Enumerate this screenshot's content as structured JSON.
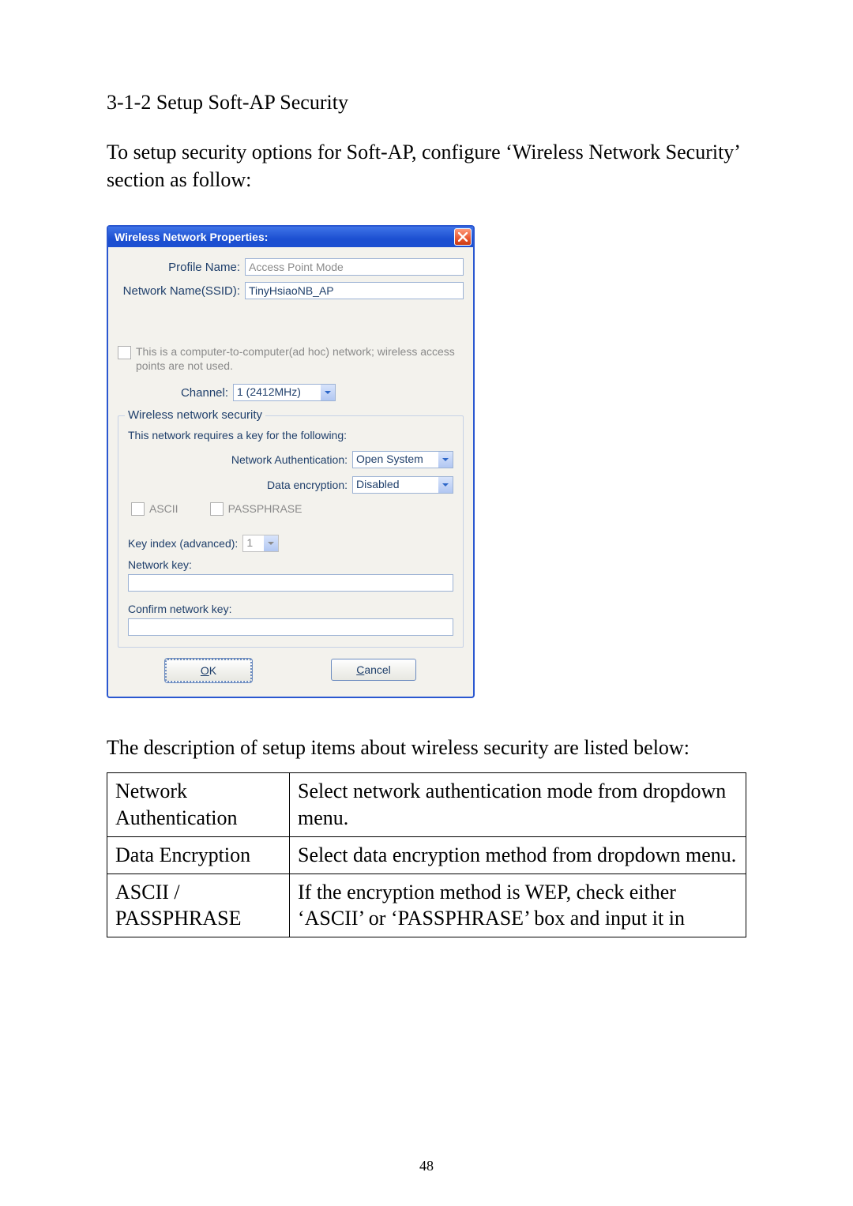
{
  "heading": "3-1-2 Setup Soft-AP Security",
  "intro": "To setup security options for Soft-AP, configure ‘Wireless Network Security’ section as follow:",
  "dialog": {
    "title": "Wireless Network Properties:",
    "close_icon": "close-icon",
    "profile_label": "Profile Name:",
    "profile_value": "Access Point Mode",
    "ssid_label": "Network Name(SSID):",
    "ssid_value": "TinyHsiaoNB_AP",
    "adhoc_text": "This is a computer-to-computer(ad hoc) network; wireless access points are not used.",
    "channel_label": "Channel:",
    "channel_value": "1  (2412MHz)",
    "fieldset_legend": "Wireless network security",
    "fieldset_text": "This network requires a key for the following:",
    "auth_label": "Network Authentication:",
    "auth_value": "Open System",
    "enc_label": "Data encryption:",
    "enc_value": "Disabled",
    "ascii_label": "ASCII",
    "pass_label": "PASSPHRASE",
    "keyidx_label": "Key index (advanced):",
    "keyidx_value": "1",
    "netkey_label": "Network key:",
    "confirm_label": "Confirm network key:",
    "ok_label": "OK",
    "ok_letter": "O",
    "ok_rest": "K",
    "cancel_label": "Cancel",
    "cancel_letter": "C",
    "cancel_rest": "ancel"
  },
  "post_text": "The description of setup items about wireless security are listed below:",
  "table": {
    "rows": [
      {
        "c1": "Network Authentication",
        "c2": "Select network authentication mode from dropdown menu."
      },
      {
        "c1": "Data Encryption",
        "c2": "Select data encryption method from dropdown menu."
      },
      {
        "c1": "ASCII / PASSPHRASE",
        "c2": "If the encryption method is WEP, check either ‘ASCII’ or ‘PASSPHRASE’ box and input it in"
      }
    ]
  },
  "page_number": "48"
}
